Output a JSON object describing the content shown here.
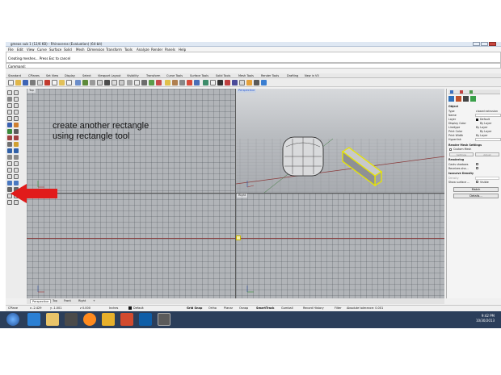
{
  "window": {
    "title": "gmeas sub 1 (12/6 KB) - Rhinoceros (Evaluation) (64-bit)"
  },
  "menu": [
    "File",
    "Edit",
    "View",
    "Curve",
    "Surface",
    "Solid",
    "Mesh",
    "Dimension",
    "Transform",
    "Tools",
    "Analyze",
    "Render",
    "Panels",
    "Help"
  ],
  "command": {
    "history": "Creating meshes... Press Esc to cancel",
    "prompt": "Command:"
  },
  "toolbar_tabs": [
    "Standard",
    "CPlanes",
    "Set View",
    "Display",
    "Select",
    "Viewport Layout",
    "Visibility",
    "Transform",
    "Curve Tools",
    "Surface Tools",
    "Solid Tools",
    "Mesh Tools",
    "Render Tools",
    "Drafting",
    "New in V5"
  ],
  "viewports": {
    "top": "Top",
    "perspective": "Perspective",
    "front": "Front",
    "right": "Right"
  },
  "annotation": {
    "line1": "create another rectangle",
    "line2": "using rectangle tool"
  },
  "viewport_tabs": [
    "Perspective",
    "Top",
    "Front",
    "Right"
  ],
  "status": {
    "cplane": "CPlane",
    "x": "x -2.429",
    "y": "y -1.001",
    "z": "z 0.000",
    "units": "Inches",
    "layer": "Default",
    "grid_snap": "Grid Snap",
    "ortho": "Ortho",
    "planar": "Planar",
    "osnap": "Osnap",
    "smarttrack": "SmartTrack",
    "gumball": "Gumball",
    "record_history": "Record History",
    "filter": "Filter",
    "tolerance": "Absolute tolerance: 0.001"
  },
  "properties": {
    "section_object": "Object",
    "rows": [
      {
        "label": "Type",
        "value": "closed extrusion"
      },
      {
        "label": "Name",
        "value": ""
      },
      {
        "label": "Layer",
        "value": "Default"
      },
      {
        "label": "Display Color",
        "value": "By Layer"
      },
      {
        "label": "Linetype",
        "value": "By Layer"
      },
      {
        "label": "Print Color",
        "value": "By Layer"
      },
      {
        "label": "Print Width",
        "value": "By Layer"
      },
      {
        "label": "Hyperlink",
        "value": ""
      }
    ],
    "section_mesh": "Render Mesh Settings",
    "custom_mesh": "Custom Mesh",
    "settings_label": "Settings",
    "adjust_label": "Adjust",
    "section_rendering": "Rendering",
    "casts_shadows": "Casts shadows",
    "receives_shadows": "Receives sha...",
    "section_isocurve": "Isocurve Density",
    "density": "Density",
    "show_surface": "Show surface ...",
    "visible": "Visible",
    "match_button": "Match",
    "details_button": "Details..."
  },
  "clock": {
    "time": "9:42 PM",
    "date": "10/30/2013"
  },
  "colors": {
    "viewport_bg": "#b1b4b8",
    "accent_red": "#e11b1b",
    "selection_yellow": "#e8e600",
    "taskbar": "#2b3e5a"
  }
}
